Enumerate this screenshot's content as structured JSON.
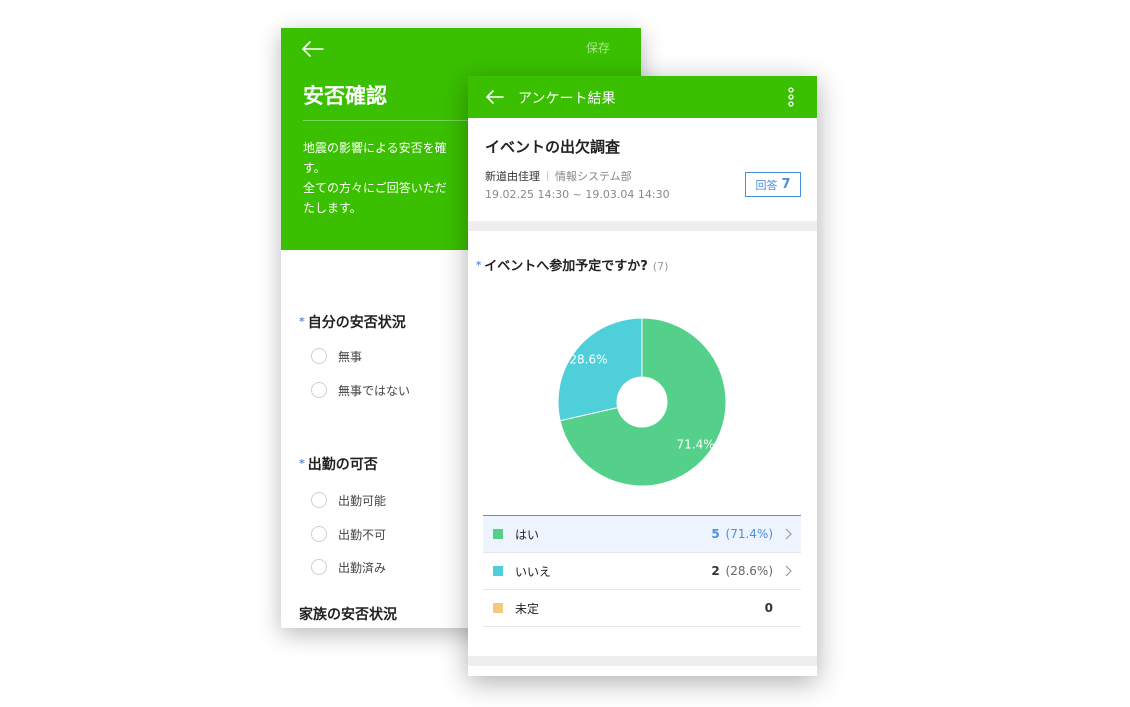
{
  "back_card": {
    "save_label": "保存",
    "title": "安否確認",
    "description": [
      "地震の影響による安否を確",
      "す。",
      "全ての方々にご回答いただ",
      "たします。"
    ],
    "questions": [
      {
        "title": "自分の安否状況",
        "required": "*",
        "options": [
          "無事",
          "無事ではない"
        ]
      },
      {
        "title": "出勤の可否",
        "required": "*",
        "options": [
          "出勤可能",
          "出勤不可",
          "出勤済み"
        ]
      },
      {
        "title": "家族の安否状況"
      }
    ],
    "icons": {
      "back": "back-arrow-icon"
    }
  },
  "front_card": {
    "header_title": "アンケート結果",
    "survey_title": "イベントの出欠調査",
    "author": "新道由佳理",
    "department": "情報システム部",
    "period": "19.02.25 14:30 ~ 19.03.04 14:30",
    "answers_label": "回答",
    "answers_count": "7",
    "question": {
      "required": "*",
      "text": "イベントへ参加予定ですか?",
      "count": "(7)"
    },
    "legend": [
      {
        "label": "はい",
        "count": "5",
        "percent": "(71.4%)",
        "color": "#55d08a",
        "selected": true
      },
      {
        "label": "いいえ",
        "count": "2",
        "percent": "(28.6%)",
        "color": "#4ecfd9",
        "selected": false
      },
      {
        "label": "未定",
        "count": "0",
        "percent": "",
        "color": "#f5c97e",
        "selected": false
      }
    ],
    "icons": {
      "back": "back-arrow-icon",
      "menu": "more-vertical-icon"
    }
  },
  "chart_data": {
    "type": "pie",
    "donut": true,
    "categories": [
      "はい",
      "いいえ",
      "未定"
    ],
    "values": [
      5,
      2,
      0
    ],
    "percent_labels": [
      "71.4%",
      "28.6%",
      ""
    ],
    "colors": [
      "#55d08a",
      "#4ecfd9",
      "#f5c97e"
    ]
  }
}
